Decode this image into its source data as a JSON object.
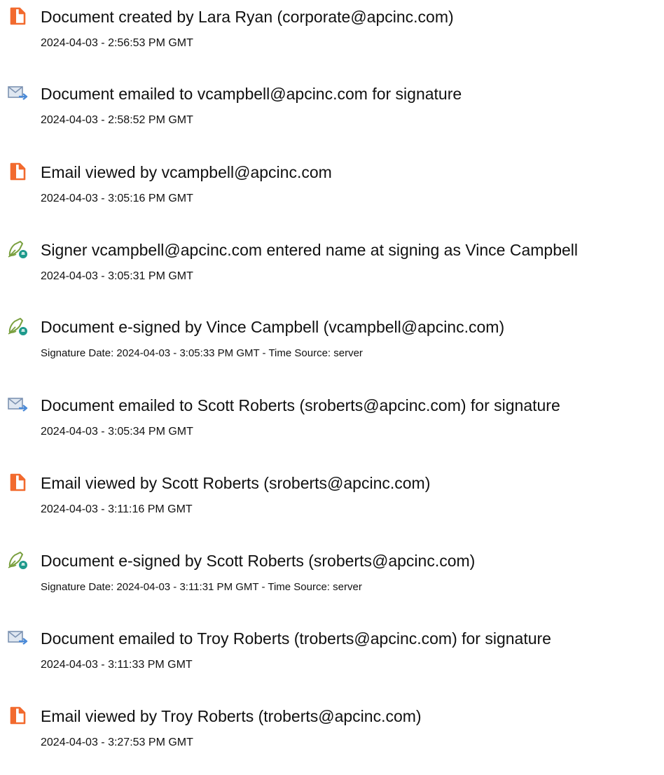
{
  "events": [
    {
      "type": "created",
      "icon": "document-created-icon",
      "text": "Document created by Lara Ryan (corporate@apcinc.com)",
      "stamp": "2024-04-03 - 2:56:53 PM GMT"
    },
    {
      "type": "emailed",
      "icon": "email-sent-icon",
      "text": "Document emailed to vcampbell@apcinc.com for signature",
      "stamp": "2024-04-03 - 2:58:52 PM GMT"
    },
    {
      "type": "viewed",
      "icon": "document-viewed-icon",
      "text": "Email viewed by vcampbell@apcinc.com",
      "stamp": "2024-04-03 - 3:05:16 PM GMT"
    },
    {
      "type": "signed",
      "icon": "e-sign-pen-icon",
      "text": "Signer vcampbell@apcinc.com entered name at signing as Vince Campbell",
      "stamp": "2024-04-03 - 3:05:31 PM GMT"
    },
    {
      "type": "signed",
      "icon": "e-sign-pen-icon",
      "text": "Document e-signed by Vince Campbell (vcampbell@apcinc.com)",
      "stamp": "Signature Date: 2024-04-03 - 3:05:33 PM GMT - Time Source: server"
    },
    {
      "type": "emailed",
      "icon": "email-sent-icon",
      "text": "Document emailed to Scott Roberts (sroberts@apcinc.com) for signature",
      "stamp": "2024-04-03 - 3:05:34 PM GMT"
    },
    {
      "type": "viewed",
      "icon": "document-viewed-icon",
      "text": "Email viewed by Scott Roberts (sroberts@apcinc.com)",
      "stamp": "2024-04-03 - 3:11:16 PM GMT"
    },
    {
      "type": "signed",
      "icon": "e-sign-pen-icon",
      "text": "Document e-signed by Scott Roberts (sroberts@apcinc.com)",
      "stamp": "Signature Date: 2024-04-03 - 3:11:31 PM GMT - Time Source: server"
    },
    {
      "type": "emailed",
      "icon": "email-sent-icon",
      "text": "Document emailed to Troy Roberts (troberts@apcinc.com) for signature",
      "stamp": "2024-04-03 - 3:11:33 PM GMT"
    },
    {
      "type": "viewed",
      "icon": "document-viewed-icon",
      "text": "Email viewed by Troy Roberts (troberts@apcinc.com)",
      "stamp": "2024-04-03 - 3:27:53 PM GMT"
    }
  ],
  "colors": {
    "document_icon": "#f26a2e",
    "email_icon_fill": "#dfe7f1",
    "email_icon_stroke": "#7d93b2",
    "email_arrow": "#4a8ad8",
    "pen_icon": "#7aa03f",
    "pen_badge": "#1e9a8c"
  }
}
